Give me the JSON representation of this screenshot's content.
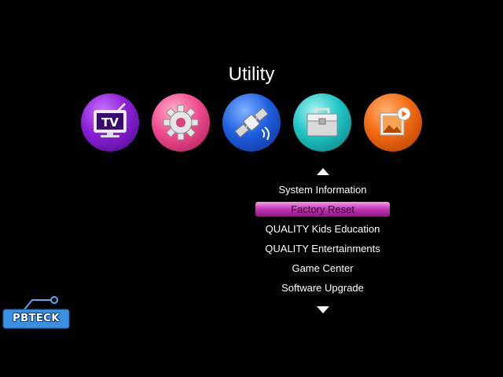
{
  "screen": {
    "title": "Utility"
  },
  "icons": [
    {
      "name": "tv-icon",
      "label": "TV"
    },
    {
      "name": "gear-icon"
    },
    {
      "name": "satellite-icon"
    },
    {
      "name": "toolbox-icon"
    },
    {
      "name": "media-icon"
    }
  ],
  "menu": {
    "items": [
      {
        "label": "System Information",
        "selected": false
      },
      {
        "label": "Factory Reset",
        "selected": true
      },
      {
        "label": "QUALITY Kids Education",
        "selected": false
      },
      {
        "label": "QUALITY Entertainments",
        "selected": false
      },
      {
        "label": "Game Center",
        "selected": false
      },
      {
        "label": "Software Upgrade",
        "selected": false
      }
    ]
  },
  "logo": {
    "text": "PBTECK"
  },
  "colors": {
    "background": "#000000",
    "highlight": "#c43ab8",
    "text": "#ffffff"
  }
}
